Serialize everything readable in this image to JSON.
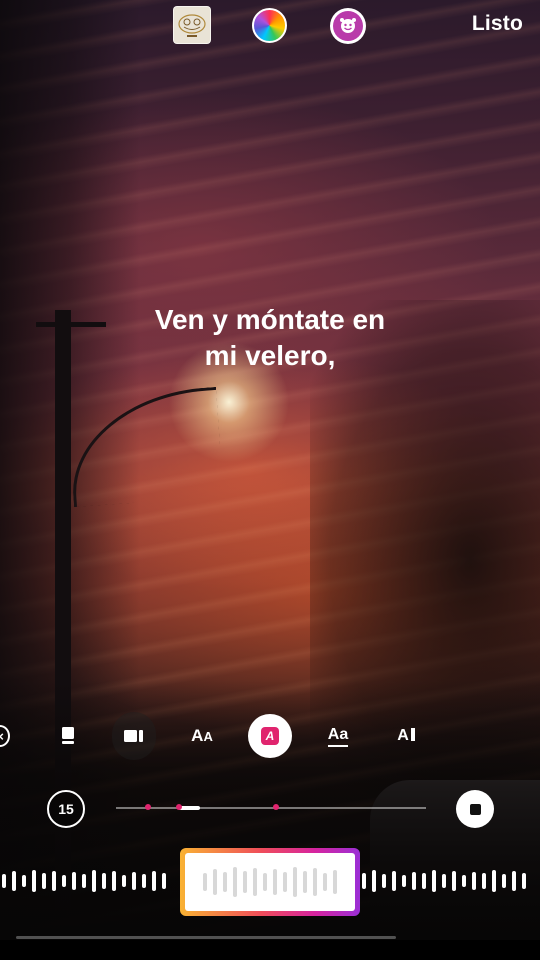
{
  "header": {
    "sticker_icon": "sticker-thumbnail-icon",
    "color_icon": "color-wheel-icon",
    "effect_icon": "face-filter-icon",
    "done_label": "Listo"
  },
  "lyrics": {
    "line1": "Ven y móntate en",
    "line2": "mi velero,"
  },
  "style_toolbar": {
    "items": [
      {
        "icon": "close-circle-icon",
        "glyph": "×"
      },
      {
        "icon": "layout-card-icon"
      },
      {
        "icon": "layout-split-icon"
      },
      {
        "icon": "font-size-icon",
        "glyph": "A",
        "glyph_small": "A"
      },
      {
        "icon": "text-style-icon",
        "glyph": "A",
        "selected": true
      },
      {
        "icon": "text-underline-icon",
        "glyph": "Aa"
      },
      {
        "icon": "text-align-icon",
        "glyph": "A"
      }
    ],
    "accent_color": "#e0246e"
  },
  "timeline": {
    "duration_label": "15",
    "stop_icon": "stop-icon"
  },
  "scrubber": {
    "window_gradient": [
      "#f9b233",
      "#ef4d5a",
      "#d6249f",
      "#9b2fd6"
    ]
  }
}
